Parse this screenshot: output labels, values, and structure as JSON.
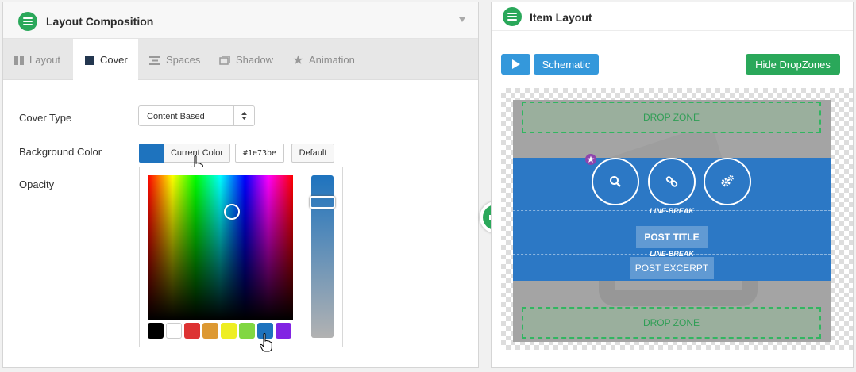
{
  "left_panel": {
    "title": "Layout Composition",
    "tabs": [
      {
        "label": "Layout",
        "icon": "columns-icon",
        "active": false
      },
      {
        "label": "Cover",
        "icon": "square-icon",
        "active": true
      },
      {
        "label": "Spaces",
        "icon": "spaces-icon",
        "active": false
      },
      {
        "label": "Shadow",
        "icon": "shadow-icon",
        "active": false
      },
      {
        "label": "Animation",
        "icon": "star-icon",
        "active": false
      }
    ],
    "cover_type_label": "Cover Type",
    "cover_type_value": "Content Based",
    "bg_color_label": "Background Color",
    "current_color_button": "Current Color",
    "hex_value": "#1e73be",
    "default_button": "Default",
    "opacity_label": "Opacity",
    "palette": [
      "#000000",
      "#ffffff",
      "#dd3333",
      "#dd9933",
      "#eeee22",
      "#81d742",
      "#1e73be",
      "#8224e3"
    ],
    "selected_color": "#1e73be"
  },
  "right_panel": {
    "title": "Item Layout",
    "play_icon": "play-icon",
    "schematic_button": "Schematic",
    "hide_dropzones_button": "Hide DropZones",
    "drop_zone_top": "DROP ZONE",
    "drop_zone_bottom": "DROP ZONE",
    "action_icons": [
      "search-icon",
      "link-icon",
      "gears-icon"
    ],
    "line_break_1": "LINE-BREAK",
    "post_title": "POST TITLE",
    "line_break_2": "LINE-BREAK",
    "post_excerpt": "POST EXCERPT"
  },
  "colors": {
    "accent_green": "#2aa85a",
    "accent_blue": "#3498db",
    "cover_blue": "#1e73be"
  }
}
